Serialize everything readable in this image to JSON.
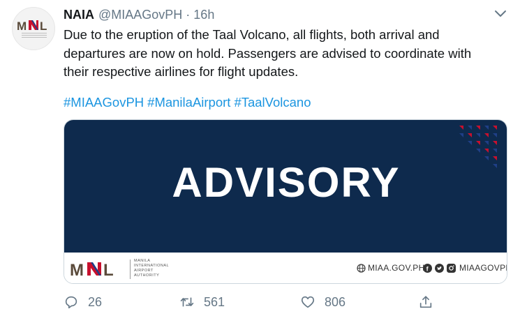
{
  "tweet": {
    "display_name": "NAIA",
    "handle": "@MIAAGovPH",
    "separator": "·",
    "time": "16h",
    "text_lines": [
      "Due to the eruption of the Taal Volcano, all flights, both arrival and",
      "departures are now on hold. Passengers are advised to coordinate with",
      "their respective airlines for flight updates."
    ],
    "hashtags": [
      "#MIAAGovPH",
      "#ManilaAirport",
      "#TaalVolcano"
    ]
  },
  "avatar": {
    "logo_text": "MNL"
  },
  "card": {
    "headline": "ADVISORY",
    "logo_text": "MNL",
    "authority_lines": [
      "MANILA",
      "INTERNATIONAL",
      "AIRPORT",
      "AUTHORITY"
    ],
    "website": "MIAA.GOV.PH",
    "social_handle": "MIAAGOVPH"
  },
  "actions": {
    "replies": "26",
    "retweets": "561",
    "likes": "806"
  },
  "icons": {
    "menu": "chevron-down-icon",
    "reply": "reply-icon",
    "retweet": "retweet-icon",
    "like": "heart-icon",
    "share": "share-icon"
  },
  "colors": {
    "banner": "#0e2a4d",
    "link": "#1b95e0",
    "muted": "#657786",
    "logo_red": "#c8102e",
    "logo_blue": "#1f3f87",
    "logo_brown": "#5a4a3a"
  }
}
